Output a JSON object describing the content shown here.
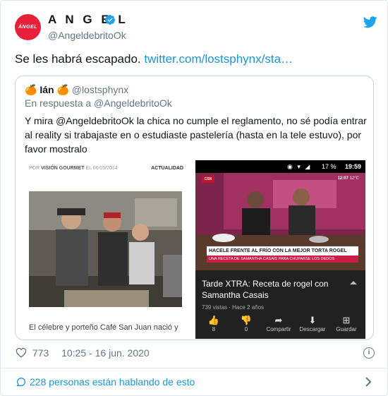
{
  "author": {
    "avatar_text": "ÁNGEL",
    "name": "A N G E L",
    "handle": "@AngeldebritoOk"
  },
  "tweet": {
    "text": "Se les habrá escapado.",
    "link": "twitter.com/lostsphynx/sta…"
  },
  "quote": {
    "emoji": "🍊",
    "name": "Ián",
    "handle": "@lostsphynx",
    "reply_to": "En respuesta a @AngeldebritoOk",
    "text": "Y mira @AngeldebritoOk la chica no cumple el reglamento, no sé podía entrar al reality si trabajaste en o estudiaste pastelería (hasta en la tele estuvo), por favor mostralo"
  },
  "article": {
    "by": "POR",
    "source": "VISIÓN GOURMET",
    "date": "EL 06/05/2014",
    "section": "ACTUALIDAD",
    "body": "El célebre y porteño Café San Juan nació y"
  },
  "youtube": {
    "battery": "17 %",
    "clock": "19:59",
    "channel": "CSN",
    "overlay_time": "12:07",
    "overlay_temp": "12°C",
    "banner_main": "HACELE FRENTE AL FRÍO CON LA MEJOR TORTA ROGEL",
    "banner_sub": "UNA RECETA DE SAMANTHA CASAIS PARA CHUPARSE LOS DEDOS",
    "title": "Tarde XTRA: Receta de rogel con Samantha Casais",
    "views": "739 vistas · Hace 2 años",
    "actions": [
      {
        "label": "8"
      },
      {
        "label": "0"
      },
      {
        "label": "Compartir"
      },
      {
        "label": "Descargar"
      },
      {
        "label": "Guardar"
      }
    ]
  },
  "footer": {
    "likes": "773",
    "timestamp": "10:25 - 16 jun. 2020",
    "talking": "228 personas están hablando de esto"
  },
  "colors": {
    "link": "#1b95e0",
    "avatar": "#e8203a",
    "muted": "#657786"
  }
}
